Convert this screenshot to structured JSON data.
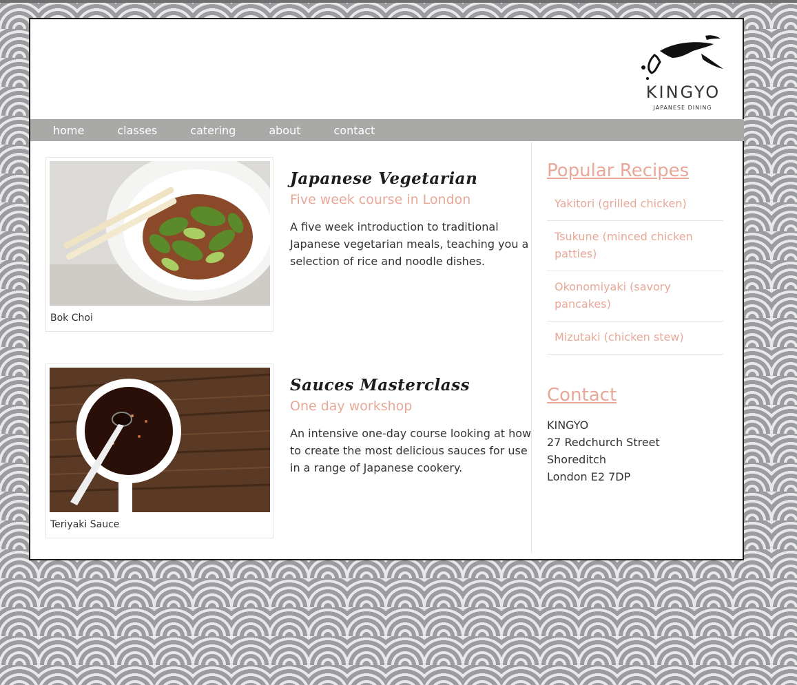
{
  "brand": {
    "name": "KINGYO",
    "tagline": "JAPANESE DINING"
  },
  "nav": {
    "items": [
      "home",
      "classes",
      "catering",
      "about",
      "contact"
    ]
  },
  "courses": [
    {
      "title": "Japanese Vegetarian",
      "subtitle": "Five week course in London",
      "description": "A five week introduction to traditional Japanese vegetarian meals, teaching you a selection of rice and noodle dishes.",
      "caption": "Bok Choi"
    },
    {
      "title": "Sauces Masterclass",
      "subtitle": "One day workshop",
      "description": "An intensive one-day course looking at how to create the most delicious sauces for use in a range of Japanese cookery.",
      "caption": "Teriyaki Sauce"
    }
  ],
  "sidebar": {
    "popular_title": "Popular Recipes",
    "recipes": [
      "Yakitori (grilled chicken)",
      "Tsukune (minced chicken patties)",
      "Okonomiyaki (savory pancakes)",
      "Mizutaki (chicken stew)"
    ],
    "contact_title": "Contact",
    "address": [
      "KINGYO",
      "27 Redchurch Street",
      "Shoreditch",
      "London E2 7DP"
    ]
  },
  "colors": {
    "accent": "#e8a898",
    "nav_bg": "#a9a9a7",
    "text": "#333333",
    "heading": "#1d1d1d"
  }
}
